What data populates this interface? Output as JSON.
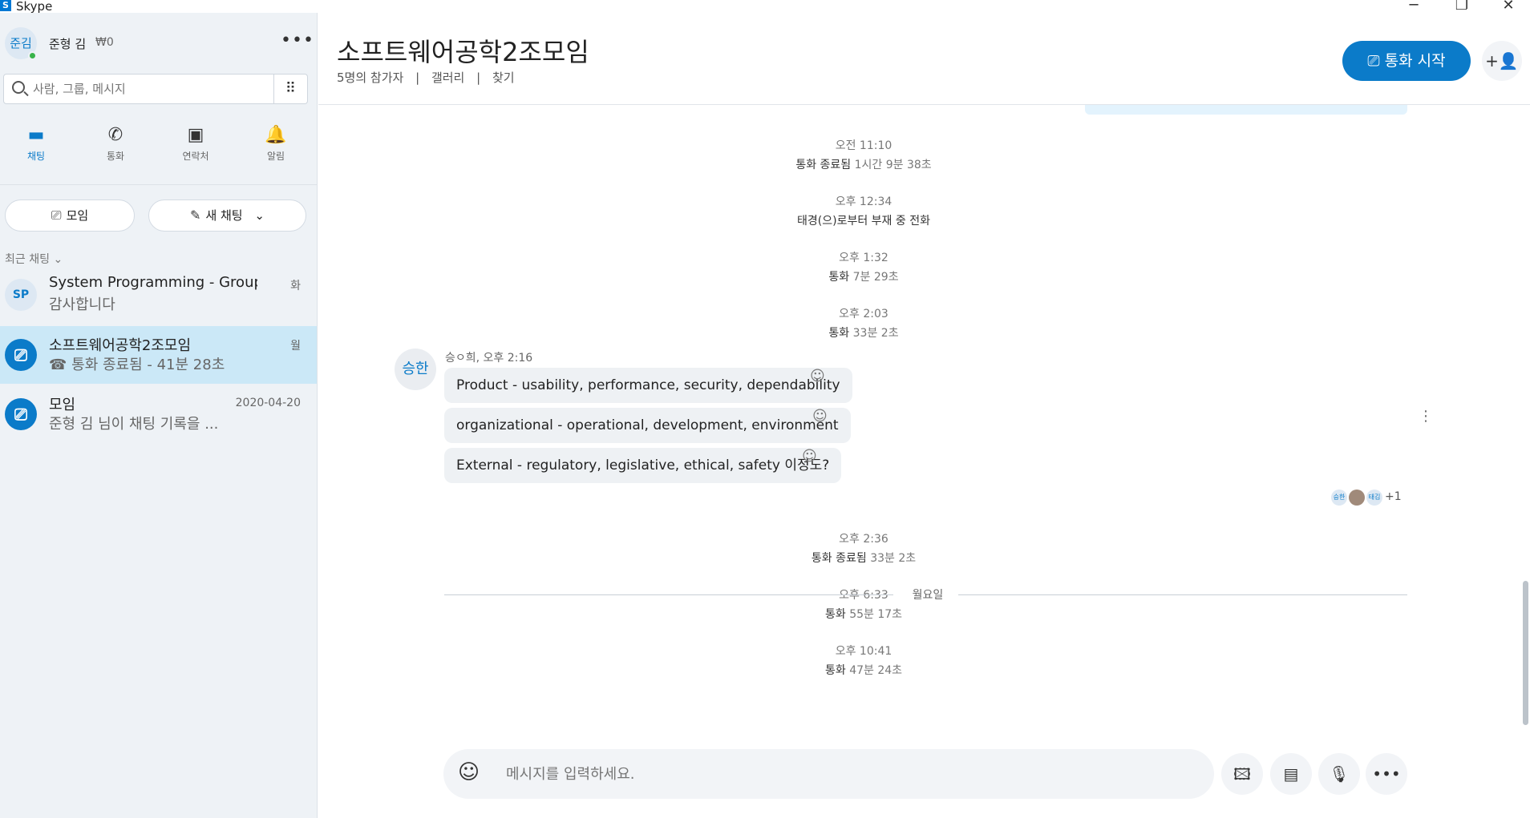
{
  "app": {
    "title": "Skype",
    "logo": "S"
  },
  "window": {
    "minimize": "─",
    "restore": "❐",
    "close": "✕"
  },
  "profile": {
    "initials": "준김",
    "name": "준형 김",
    "balance": "₩0",
    "more": "•••"
  },
  "search": {
    "placeholder": "사람, 그룹, 메시지",
    "dialpad_icon": "⠿"
  },
  "nav": [
    {
      "label": "채팅",
      "icon": "chat-icon",
      "glyph": "▬",
      "active": true
    },
    {
      "label": "통화",
      "icon": "phone-icon",
      "glyph": "✆",
      "active": false
    },
    {
      "label": "연락처",
      "icon": "contacts-icon",
      "glyph": "▣",
      "active": false
    },
    {
      "label": "알림",
      "icon": "bell-icon",
      "glyph": "🔔",
      "active": false
    }
  ],
  "buttons": {
    "meeting_label": "모임",
    "meeting_glyph": "⎚",
    "new_chat_label": "새 채팅",
    "new_chat_glyph": "✎",
    "new_chat_chevron": "⌄"
  },
  "recent": {
    "label": "최근 채팅",
    "chevron": "⌄"
  },
  "chats": [
    {
      "avatar": "SP",
      "name": "System Programming - Group A",
      "preview": "감사합니다",
      "date": "화",
      "active": false
    },
    {
      "avatar": "⎚",
      "name": "소프트웨어공학2조모임",
      "preview": "☎ 통화 종료됨 - 41분 28초",
      "date": "월",
      "active": true
    },
    {
      "avatar": "⎚",
      "name": "모임",
      "preview": "준형 김 님이 채팅 기록을 ...",
      "date": "2020-04-20",
      "active": false
    }
  ],
  "conversation": {
    "title": "소프트웨어공학2조모임",
    "participants": "5명의 참가자",
    "gallery": "갤러리",
    "find": "찾기",
    "sep": "|",
    "call_label": "통화 시작",
    "call_glyph": "⎚",
    "add_person_glyph": "+👤"
  },
  "events_top": [
    {
      "time": "오전 11:10",
      "label": "통화 종료됨",
      "dur": "1시간 9분 38초"
    },
    {
      "time": "오후 12:34",
      "label": "태경(으)로부터 부재 중 전화",
      "dur": ""
    },
    {
      "time": "오후 1:32",
      "label": "통화",
      "dur": "7분 29초"
    },
    {
      "time": "오후 2:03",
      "label": "통화",
      "dur": "33분 2초"
    }
  ],
  "message_group": {
    "avatar": "승한",
    "meta": "승ㅇ희, 오후 2:16",
    "messages": [
      "Product - usability, performance, security, dependability",
      "organizational - operational, development, environment",
      "External - regulatory, legislative, ethical, safety 이정도?"
    ],
    "reaction_glyph": "☺",
    "more_glyph": "⋮",
    "read_by": [
      "승한",
      "",
      "태김"
    ],
    "read_extra": "+1"
  },
  "events_bottom": [
    {
      "time": "오후 2:36",
      "label": "통화 종료됨",
      "dur": "33분 2초"
    },
    {
      "time": "오후 6:33",
      "label": "통화",
      "dur": "55분 17초"
    },
    {
      "time": "오후 10:41",
      "label": "통화",
      "dur": "47분 24초"
    }
  ],
  "day_divider": "월요일",
  "composer": {
    "placeholder": "메시지를 입력하세요.",
    "emoji_glyph": "☺",
    "media_glyph": "🖾",
    "contact_glyph": "▤",
    "mic_glyph": "🎙",
    "more_glyph": "•••"
  },
  "colors": {
    "accent": "#0b7bc9",
    "sidebar_bg": "#eef2f6",
    "active_chat": "#cbe8f7",
    "bubble": "#eef1f4",
    "presence": "#38b34a"
  }
}
